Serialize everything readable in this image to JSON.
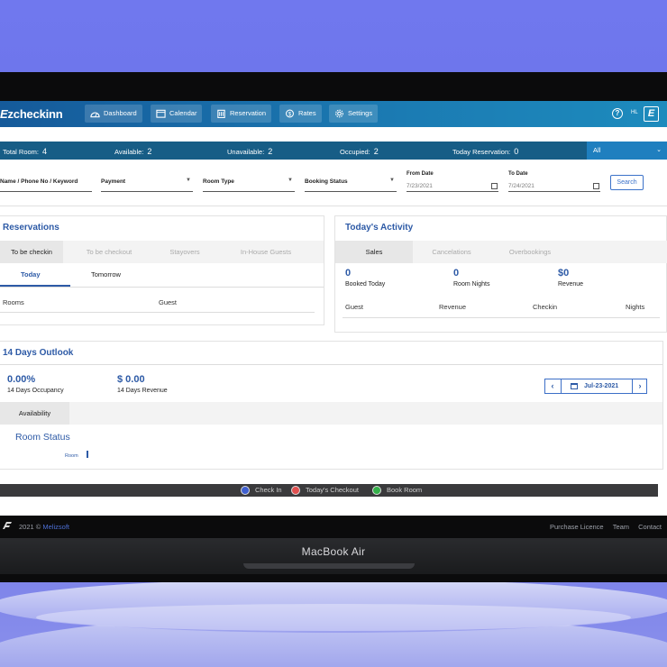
{
  "app": {
    "logo_text": "zcheckinn",
    "logo_mark": "E"
  },
  "nav": {
    "items": [
      {
        "label": "Dashboard",
        "icon": "dashboard-icon"
      },
      {
        "label": "Calendar",
        "icon": "calendar-icon"
      },
      {
        "label": "Reservation",
        "icon": "building-icon"
      },
      {
        "label": "Rates",
        "icon": "dollar-icon"
      },
      {
        "label": "Settings",
        "icon": "gear-icon"
      }
    ],
    "help": "?",
    "lang": "HL",
    "brand_icon": "E"
  },
  "stats": {
    "total_room_label": "Total Room:",
    "total_room": "4",
    "available_label": "Available:",
    "available": "2",
    "unavailable_label": "Unavailable:",
    "unavailable": "2",
    "occupied_label": "Occupied:",
    "occupied": "2",
    "today_res_label": "Today Reservation:",
    "today_res": "0",
    "filter_value": "All"
  },
  "filters": {
    "keyword": "Name / Phone No / Keyword",
    "payment": "Payment",
    "room_type": "Room Type",
    "booking_status": "Booking Status",
    "from_label": "From Date",
    "from_value": "7/23/2021",
    "to_label": "To Date",
    "to_value": "7/24/2021",
    "search": "Search"
  },
  "reservations": {
    "title": "Reservations",
    "tabs": [
      "To be checkin",
      "To be checkout",
      "Stayovers",
      "In-House Guests"
    ],
    "subtabs": [
      "Today",
      "Tomorrow"
    ],
    "columns": [
      "Rooms",
      "Guest"
    ]
  },
  "activity": {
    "title": "Today's Activity",
    "tabs": [
      "Sales",
      "Cancelations",
      "Overbookings"
    ],
    "booked_value": "0",
    "booked_label": "Booked Today",
    "nights_value": "0",
    "nights_label": "Room Nights",
    "revenue_value": "$0",
    "revenue_label": "Revenue",
    "columns": [
      "Guest",
      "Revenue",
      "Checkin",
      "Nights"
    ]
  },
  "outlook": {
    "title": "14 Days Outlook",
    "occupancy_value": "0.00%",
    "occupancy_label": "14 Days Occupancy",
    "revenue_value": "$ 0.00",
    "revenue_label": "14 Days Revenue",
    "date": "Jul-23-2021",
    "tab": "Availability",
    "room_status": "Room Status",
    "room_label": "Room"
  },
  "legend": [
    {
      "label": "Check In",
      "color": "#3f5fcf"
    },
    {
      "label": "Today's Checkout",
      "color": "#e05050"
    },
    {
      "label": "Book Room",
      "color": "#35b04a"
    }
  ],
  "footer": {
    "year": "2021 ©",
    "brand": "Melizsoft",
    "links": [
      "Purchase Licence",
      "Team",
      "Contact"
    ]
  },
  "device": {
    "label": "MacBook Air"
  }
}
